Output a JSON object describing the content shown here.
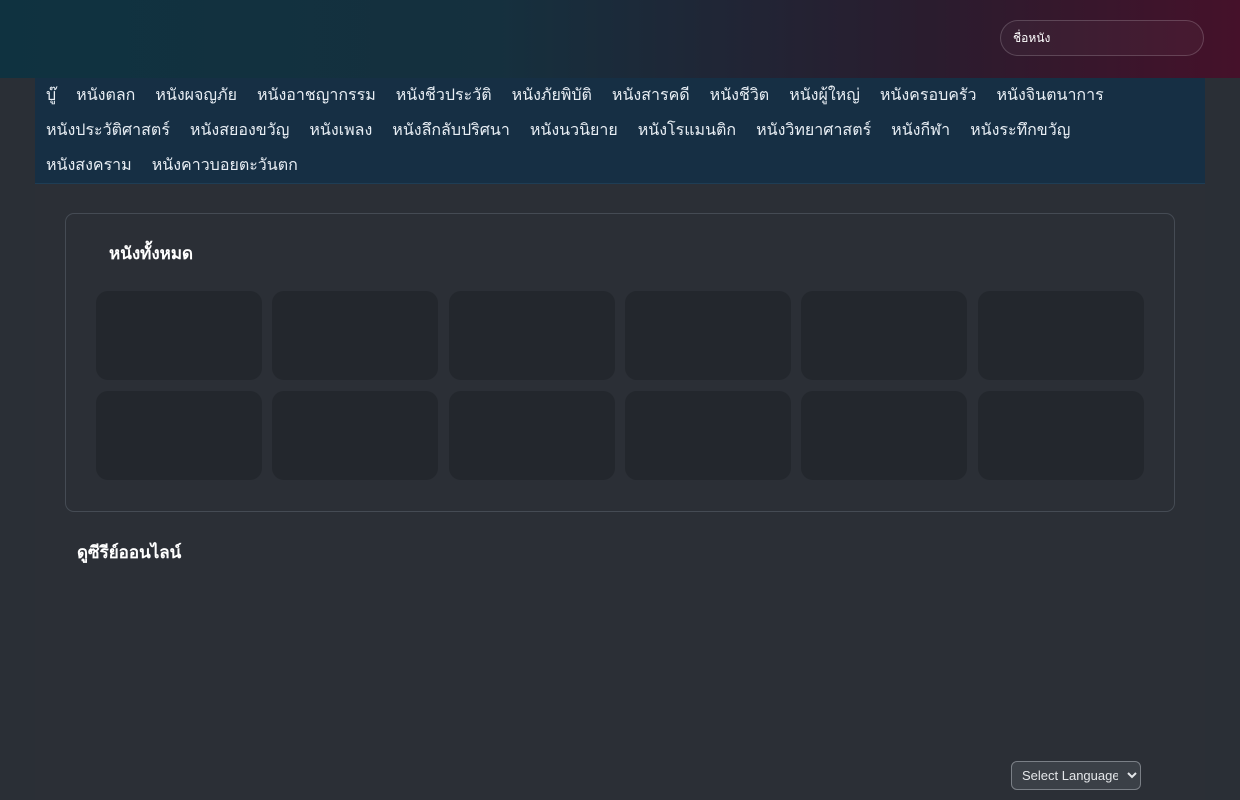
{
  "search": {
    "placeholder": "ชื่อหนัง"
  },
  "categories": {
    "row1": [
      "บู๊",
      "หนังตลก",
      "หนังผจญภัย",
      "หนังอาชญากรรม",
      "หนังชีวประวัติ",
      "หนังภัยพิบัติ",
      "หนังสารคดี",
      "หนังชีวิต",
      "หนังผู้ใหญ่",
      "หนังครอบครัว",
      "หนังจินตนาการ"
    ],
    "row2": [
      "หนังประวัติศาสตร์",
      "หนังสยองขวัญ",
      "หนังเพลง",
      "หนังลึกลับปริศนา",
      "หนังนวนิยาย",
      "หนังโรแมนติก",
      "หนังวิทยาศาสตร์",
      "หนังกีฬา",
      "หนังระทึกขวัญ"
    ],
    "row3": [
      "หนังสงคราม",
      "หนังคาวบอยตะวันตก"
    ]
  },
  "all_movies": {
    "title": "หนังทั้งหมด"
  },
  "series": {
    "title": "ดูซีรีย์ออนไลน์"
  },
  "language": {
    "selected": "Select Language"
  }
}
